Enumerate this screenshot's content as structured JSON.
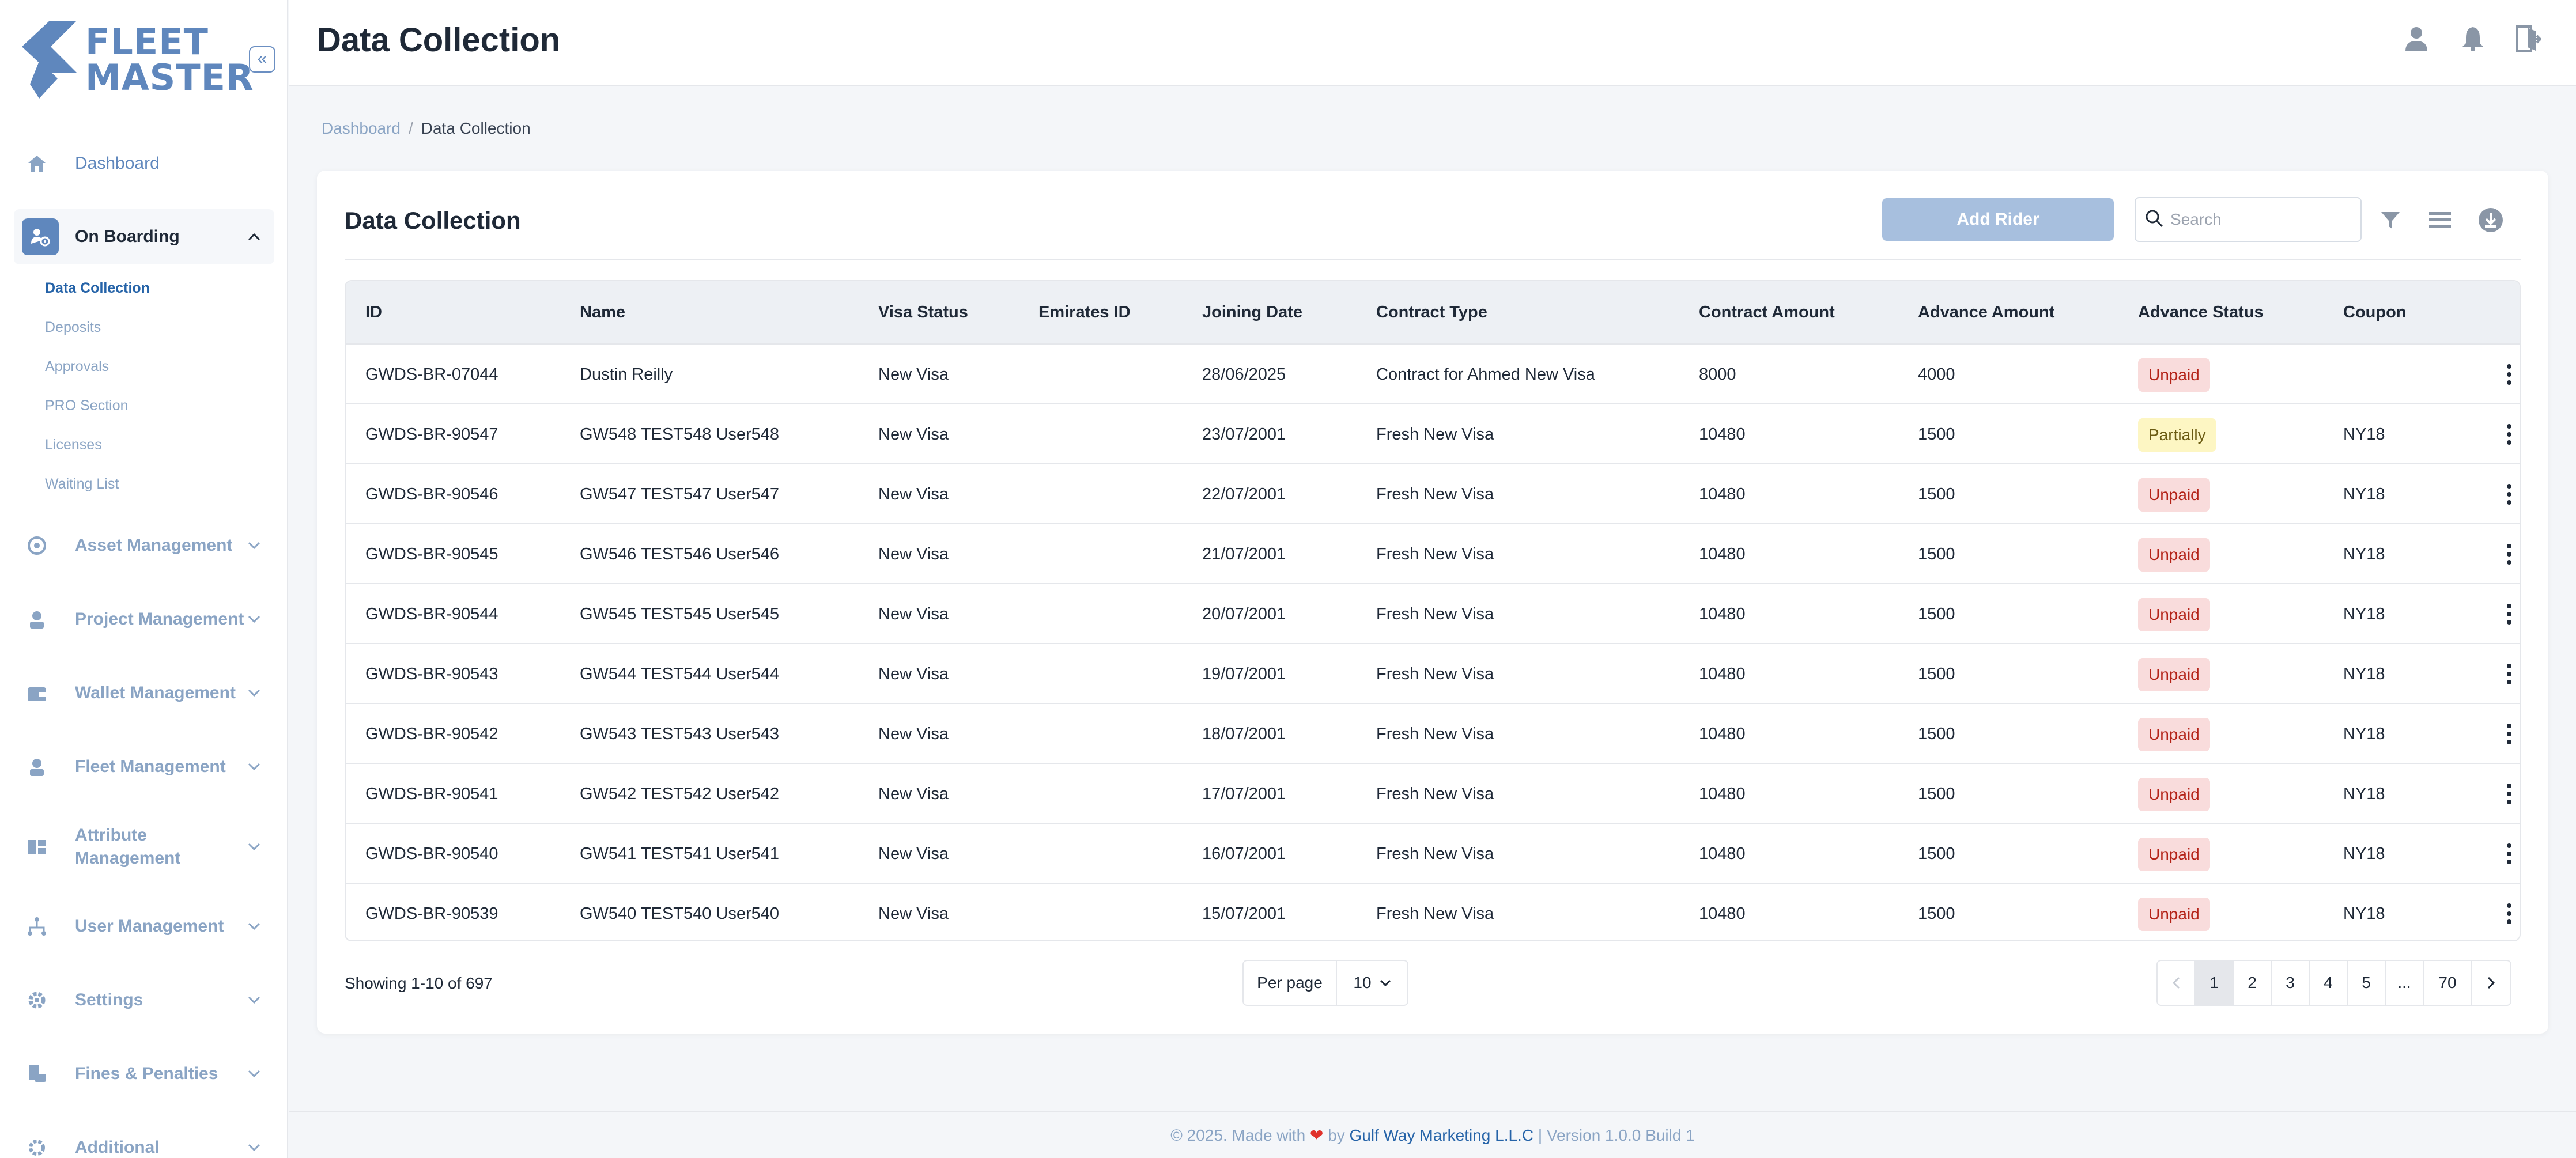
{
  "brand": {
    "line1": "FLEET",
    "line2": "MASTER",
    "color": "#5f87bd"
  },
  "sidebar": {
    "items": [
      {
        "label": "Dashboard",
        "icon": "home-icon"
      },
      {
        "label": "On Boarding",
        "icon": "onboarding-icon",
        "expanded": true
      },
      {
        "label": "Asset Management",
        "icon": "asset-icon"
      },
      {
        "label": "Project Management",
        "icon": "project-icon"
      },
      {
        "label": "Wallet Management",
        "icon": "wallet-icon"
      },
      {
        "label": "Fleet Management",
        "icon": "fleet-icon"
      },
      {
        "label_line1": "Attribute",
        "label_line2": "Management",
        "icon": "attribute-icon"
      },
      {
        "label": "User Management",
        "icon": "users-icon"
      },
      {
        "label": "Settings",
        "icon": "gear-icon"
      },
      {
        "label": "Fines & Penalties",
        "icon": "fines-icon"
      },
      {
        "label": "Additional",
        "icon": "additional-icon"
      }
    ],
    "onboarding_sub": [
      "Data Collection",
      "Deposits",
      "Approvals",
      "PRO Section",
      "Licenses",
      "Waiting List"
    ]
  },
  "header": {
    "title": "Data Collection"
  },
  "breadcrumb": {
    "home": "Dashboard",
    "separator": "/",
    "current": "Data Collection"
  },
  "card": {
    "title": "Data Collection",
    "add_button": "Add Rider",
    "search_placeholder": "Search"
  },
  "table": {
    "columns": [
      "ID",
      "Name",
      "Visa Status",
      "Emirates ID",
      "Joining Date",
      "Contract Type",
      "Contract Amount",
      "Advance Amount",
      "Advance Status",
      "Coupon"
    ],
    "rows": [
      {
        "id": "GWDS-BR-07044",
        "name": "Dustin Reilly",
        "visa": "New Visa",
        "emirates": "",
        "joining": "28/06/2025",
        "contract_type": "Contract for Ahmed New Visa",
        "contract_amount": "8000",
        "advance_amount": "4000",
        "advance_status": "Unpaid",
        "coupon": ""
      },
      {
        "id": "GWDS-BR-90547",
        "name": "GW548 TEST548 User548",
        "visa": "New Visa",
        "emirates": "",
        "joining": "23/07/2001",
        "contract_type": "Fresh New Visa",
        "contract_amount": "10480",
        "advance_amount": "1500",
        "advance_status": "Partially",
        "coupon": "NY18"
      },
      {
        "id": "GWDS-BR-90546",
        "name": "GW547 TEST547 User547",
        "visa": "New Visa",
        "emirates": "",
        "joining": "22/07/2001",
        "contract_type": "Fresh New Visa",
        "contract_amount": "10480",
        "advance_amount": "1500",
        "advance_status": "Unpaid",
        "coupon": "NY18"
      },
      {
        "id": "GWDS-BR-90545",
        "name": "GW546 TEST546 User546",
        "visa": "New Visa",
        "emirates": "",
        "joining": "21/07/2001",
        "contract_type": "Fresh New Visa",
        "contract_amount": "10480",
        "advance_amount": "1500",
        "advance_status": "Unpaid",
        "coupon": "NY18"
      },
      {
        "id": "GWDS-BR-90544",
        "name": "GW545 TEST545 User545",
        "visa": "New Visa",
        "emirates": "",
        "joining": "20/07/2001",
        "contract_type": "Fresh New Visa",
        "contract_amount": "10480",
        "advance_amount": "1500",
        "advance_status": "Unpaid",
        "coupon": "NY18"
      },
      {
        "id": "GWDS-BR-90543",
        "name": "GW544 TEST544 User544",
        "visa": "New Visa",
        "emirates": "",
        "joining": "19/07/2001",
        "contract_type": "Fresh New Visa",
        "contract_amount": "10480",
        "advance_amount": "1500",
        "advance_status": "Unpaid",
        "coupon": "NY18"
      },
      {
        "id": "GWDS-BR-90542",
        "name": "GW543 TEST543 User543",
        "visa": "New Visa",
        "emirates": "",
        "joining": "18/07/2001",
        "contract_type": "Fresh New Visa",
        "contract_amount": "10480",
        "advance_amount": "1500",
        "advance_status": "Unpaid",
        "coupon": "NY18"
      },
      {
        "id": "GWDS-BR-90541",
        "name": "GW542 TEST542 User542",
        "visa": "New Visa",
        "emirates": "",
        "joining": "17/07/2001",
        "contract_type": "Fresh New Visa",
        "contract_amount": "10480",
        "advance_amount": "1500",
        "advance_status": "Unpaid",
        "coupon": "NY18"
      },
      {
        "id": "GWDS-BR-90540",
        "name": "GW541 TEST541 User541",
        "visa": "New Visa",
        "emirates": "",
        "joining": "16/07/2001",
        "contract_type": "Fresh New Visa",
        "contract_amount": "10480",
        "advance_amount": "1500",
        "advance_status": "Unpaid",
        "coupon": "NY18"
      },
      {
        "id": "GWDS-BR-90539",
        "name": "GW540 TEST540 User540",
        "visa": "New Visa",
        "emirates": "",
        "joining": "15/07/2001",
        "contract_type": "Fresh New Visa",
        "contract_amount": "10480",
        "advance_amount": "1500",
        "advance_status": "Unpaid",
        "coupon": "NY18"
      }
    ]
  },
  "pagination": {
    "showing": "Showing 1-10 of 697",
    "per_page_label": "Per page",
    "per_page_value": "10",
    "pages": [
      "1",
      "2",
      "3",
      "4",
      "5",
      "...",
      "70"
    ],
    "current_page": "1"
  },
  "footer": {
    "prefix": "© 2025. Made with",
    "by": "by",
    "company": "Gulf Way Marketing L.L.C",
    "suffix": "| Version 1.0.0 Build 1"
  },
  "colors": {
    "accent": "#5f87bd",
    "button": "#a7bfde",
    "unpaid_bg": "#f9dcdc",
    "partial_bg": "#fdf6c3"
  }
}
